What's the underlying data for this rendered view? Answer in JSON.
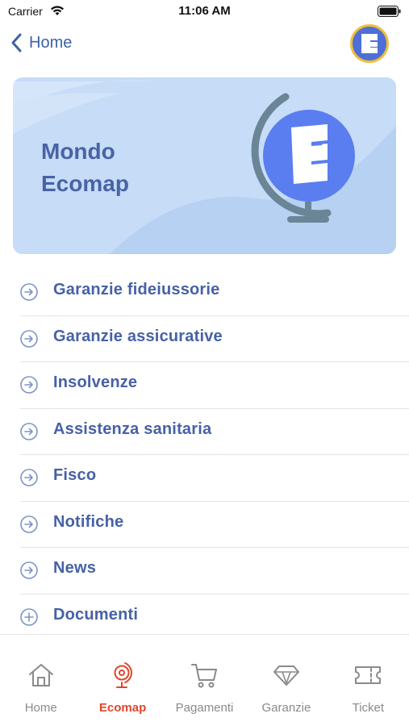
{
  "status_bar": {
    "carrier": "Carrier",
    "time": "11:06 AM"
  },
  "nav": {
    "back_label": "Home",
    "avatar_icon": "ecomap-logo-icon"
  },
  "banner": {
    "title": "Mondo\nEcomap",
    "illustration": "globe-icon"
  },
  "menu": {
    "items": [
      {
        "label": "Garanzie fideiussorie",
        "icon": "arrow-right-circle-icon"
      },
      {
        "label": "Garanzie assicurative",
        "icon": "arrow-right-circle-icon"
      },
      {
        "label": "Insolvenze",
        "icon": "arrow-right-circle-icon"
      },
      {
        "label": "Assistenza sanitaria",
        "icon": "arrow-right-circle-icon"
      },
      {
        "label": "Fisco",
        "icon": "arrow-right-circle-icon"
      },
      {
        "label": "Notifiche",
        "icon": "arrow-right-circle-icon"
      },
      {
        "label": "News",
        "icon": "arrow-right-circle-icon"
      },
      {
        "label": "Documenti",
        "icon": "plus-circle-icon"
      }
    ]
  },
  "tab_bar": {
    "active": "Ecomap",
    "tabs": [
      {
        "label": "Home",
        "icon": "home-icon"
      },
      {
        "label": "Ecomap",
        "icon": "globe-icon"
      },
      {
        "label": "Pagamenti",
        "icon": "cart-icon"
      },
      {
        "label": "Garanzie",
        "icon": "diamond-icon"
      },
      {
        "label": "Ticket",
        "icon": "ticket-icon"
      }
    ]
  },
  "colors": {
    "accent_blue": "#4661a6",
    "link_blue": "#3b63a8",
    "active_tab": "#e0452b",
    "banner_bg": "#c6dcf7",
    "avatar_ring": "#f1bd3d"
  }
}
